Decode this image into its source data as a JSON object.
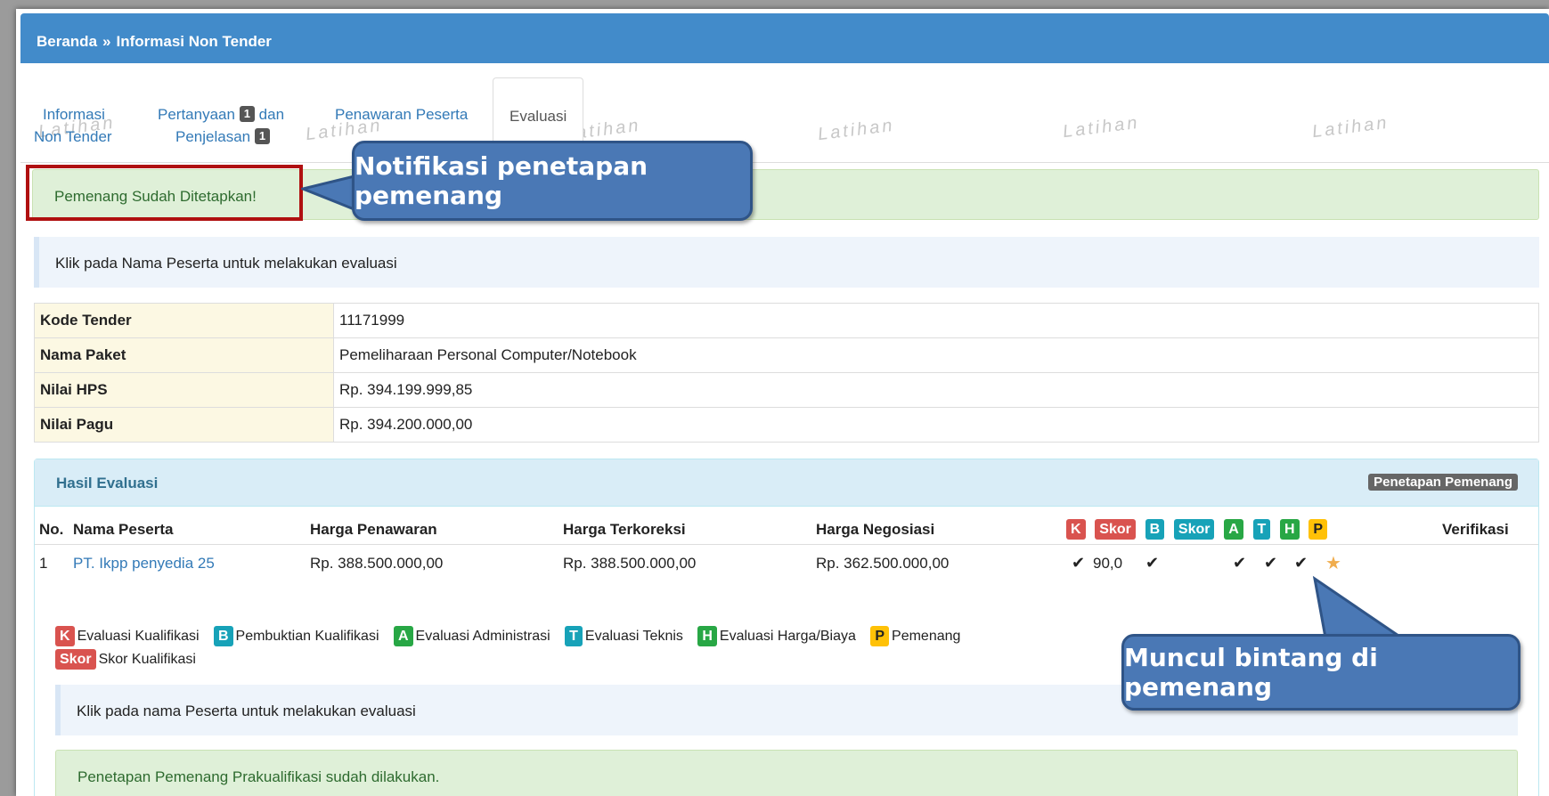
{
  "breadcrumb": {
    "home": "Beranda",
    "separator": "»",
    "current": "Informasi Non Tender"
  },
  "watermark": "Latihan",
  "tabs": [
    {
      "line1": "Informasi",
      "line2": "Non Tender"
    },
    {
      "line1": "Pertanyaan",
      "badge1": "1",
      "line1b": "dan",
      "line2": "Penjelasan",
      "badge2": "1"
    },
    {
      "label": "Penawaran Peserta"
    },
    {
      "label": "Evaluasi"
    }
  ],
  "alerts": {
    "winner_set": "Pemenang Sudah Ditetapkan!",
    "click_hint": "Klik pada Nama Peserta untuk melakukan evaluasi",
    "click_hint2": "Klik pada nama Peserta untuk melakukan evaluasi",
    "prequal_done": "Penetapan Pemenang Prakualifikasi sudah dilakukan."
  },
  "info_table": [
    {
      "key": "Kode Tender",
      "value": "11171999"
    },
    {
      "key": "Nama Paket",
      "value": "Pemeliharaan Personal Computer/Notebook"
    },
    {
      "key": "Nilai HPS",
      "value": "Rp. 394.199.999,85"
    },
    {
      "key": "Nilai Pagu",
      "value": "Rp. 394.200.000,00"
    }
  ],
  "panel": {
    "title": "Hasil Evaluasi",
    "button": "Penetapan Pemenang",
    "headers": {
      "no": "No.",
      "name": "Nama Peserta",
      "offer": "Harga Penawaran",
      "corrected": "Harga Terkoreksi",
      "negotiated": "Harga Negosiasi",
      "k": "K",
      "skor": "Skor",
      "b": "B",
      "skor2": "Skor",
      "a": "A",
      "t": "T",
      "h": "H",
      "p": "P",
      "verif": "Verifikasi"
    },
    "rows": [
      {
        "no": "1",
        "name": "PT. Ikpp penyedia 25",
        "offer": "Rp. 388.500.000,00",
        "corrected": "Rp. 388.500.000,00",
        "negotiated": "Rp. 362.500.000,00",
        "skor": "90,0",
        "check_glyph": "✔",
        "star_glyph": "★"
      }
    ],
    "legend": [
      {
        "badge": "K",
        "text": "Evaluasi Kualifikasi"
      },
      {
        "badge": "B",
        "text": "Pembuktian Kualifikasi"
      },
      {
        "badge": "A",
        "text": "Evaluasi Administrasi"
      },
      {
        "badge": "T",
        "text": "Evaluasi Teknis"
      },
      {
        "badge": "H",
        "text": "Evaluasi Harga/Biaya"
      },
      {
        "badge": "P",
        "text": "Pemenang"
      },
      {
        "badge": "Skor",
        "text": "Skor Kualifikasi"
      }
    ]
  },
  "callouts": {
    "notif": "Notifikasi penetapan pemenang",
    "star": "Muncul bintang di pemenang"
  },
  "colors": {
    "header_blue": "#428bca",
    "callout_blue": "#4a78b5",
    "highlight_red": "#b01010",
    "success_bg": "#dff0d8",
    "star": "#f0ad4e"
  }
}
